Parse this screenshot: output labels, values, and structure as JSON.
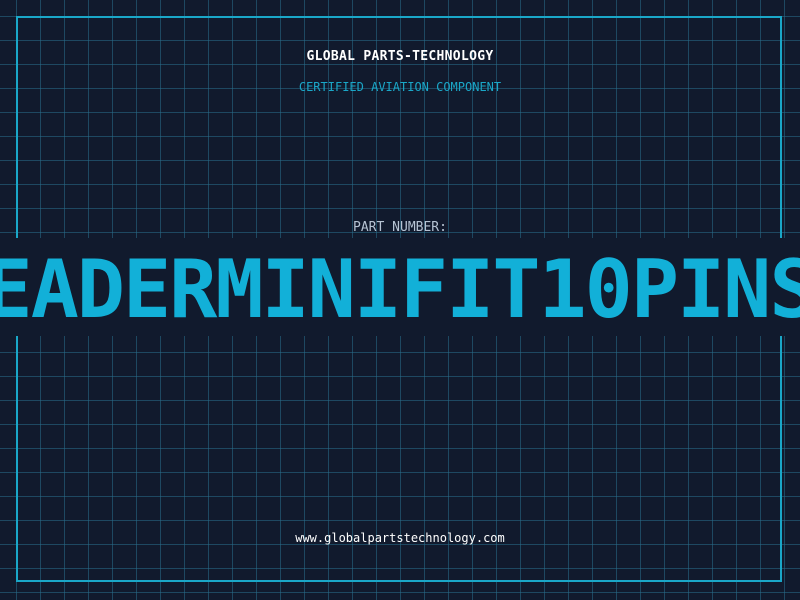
{
  "brand": {
    "name": "GLOBAL PARTS-TECHNOLOGY",
    "tagline": "CERTIFIED AVIATION COMPONENT"
  },
  "part": {
    "label": "PART NUMBER:",
    "value": "EADERMINIFIT10PINS"
  },
  "footer": {
    "website": "www.globalpartstechnology.com"
  },
  "colors": {
    "background": "#111a2d",
    "grid": "#286e8c",
    "accent": "#1aa7c8",
    "part_number": "#12b0d8",
    "text": "#ffffff",
    "label": "#b6c3d3"
  }
}
